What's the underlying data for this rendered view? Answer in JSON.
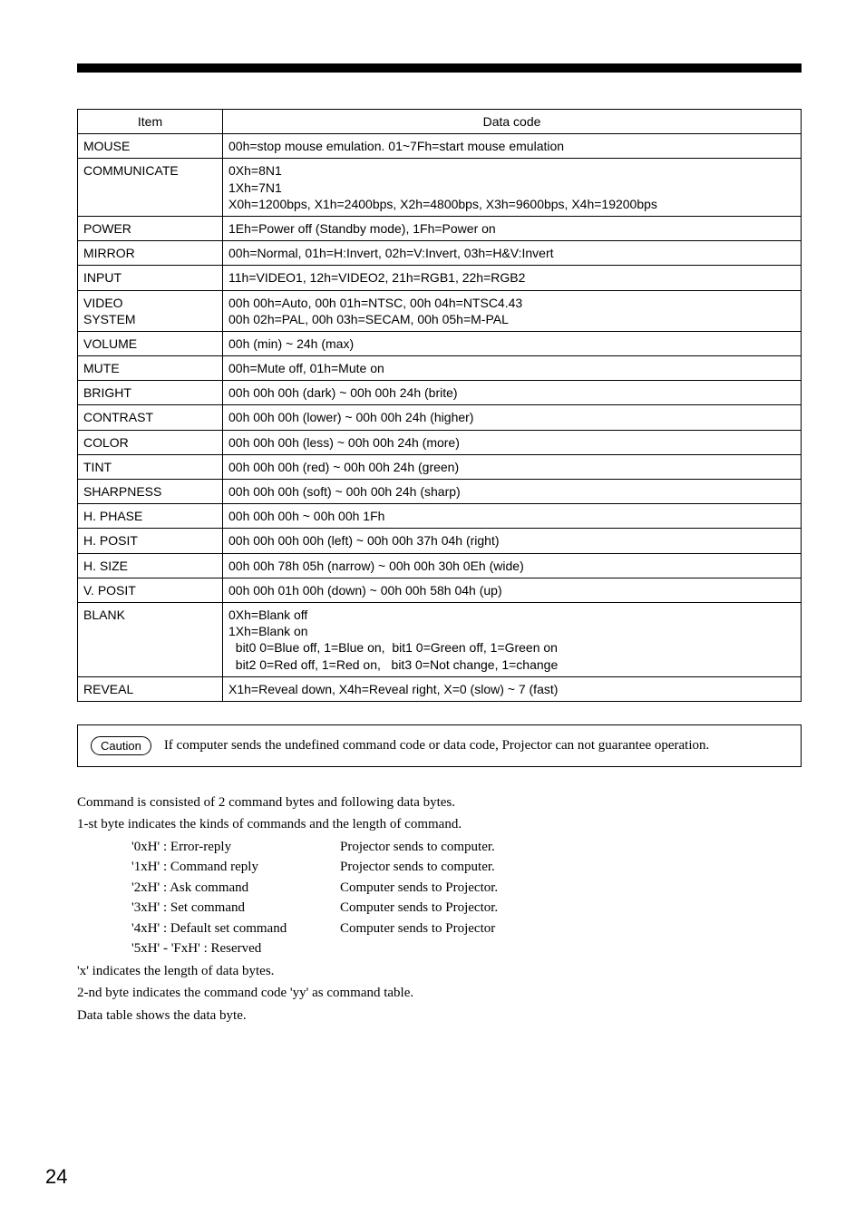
{
  "table": {
    "head_item": "Item",
    "head_data": "Data code",
    "rows": [
      {
        "item": "MOUSE",
        "data": "00h=stop mouse emulation. 01~7Fh=start mouse emulation"
      },
      {
        "item": "COMMUNICATE",
        "data": "0Xh=8N1\n1Xh=7N1\nX0h=1200bps, X1h=2400bps, X2h=4800bps, X3h=9600bps, X4h=19200bps"
      },
      {
        "item": "POWER",
        "data": "1Eh=Power off (Standby mode), 1Fh=Power on"
      },
      {
        "item": "MIRROR",
        "data": "00h=Normal, 01h=H:Invert, 02h=V:Invert, 03h=H&V:Invert"
      },
      {
        "item": "INPUT",
        "data": "11h=VIDEO1, 12h=VIDEO2, 21h=RGB1, 22h=RGB2"
      },
      {
        "item": "VIDEO\nSYSTEM",
        "data": "00h 00h=Auto, 00h 01h=NTSC, 00h 04h=NTSC4.43\n00h 02h=PAL, 00h 03h=SECAM, 00h 05h=M-PAL"
      },
      {
        "item": "VOLUME",
        "data": "00h (min) ~ 24h (max)"
      },
      {
        "item": "MUTE",
        "data": "00h=Mute off, 01h=Mute on"
      },
      {
        "item": "BRIGHT",
        "data": "00h 00h 00h (dark) ~ 00h 00h 24h (brite)"
      },
      {
        "item": "CONTRAST",
        "data": "00h 00h 00h (lower) ~ 00h 00h 24h (higher)"
      },
      {
        "item": "COLOR",
        "data": "00h 00h 00h (less) ~ 00h 00h 24h (more)"
      },
      {
        "item": "TINT",
        "data": "00h 00h 00h (red) ~ 00h 00h 24h (green)"
      },
      {
        "item": "SHARPNESS",
        "data": "00h 00h 00h (soft) ~ 00h 00h 24h (sharp)"
      },
      {
        "item": "H. PHASE",
        "data": "00h 00h 00h ~ 00h 00h 1Fh"
      },
      {
        "item": "H. POSIT",
        "data": "00h 00h 00h 00h (left) ~ 00h 00h 37h 04h (right)"
      },
      {
        "item": "H. SIZE",
        "data": "00h 00h 78h 05h (narrow) ~ 00h 00h 30h 0Eh (wide)"
      },
      {
        "item": "V. POSIT",
        "data": "00h 00h 01h 00h (down) ~ 00h 00h 58h 04h (up)"
      },
      {
        "item": "BLANK",
        "data": "0Xh=Blank off\n1Xh=Blank on\n  bit0 0=Blue off, 1=Blue on,  bit1 0=Green off, 1=Green on\n  bit2 0=Red off, 1=Red on,   bit3 0=Not change, 1=change"
      },
      {
        "item": "REVEAL",
        "data": "X1h=Reveal down, X4h=Reveal right, X=0 (slow) ~ 7 (fast)"
      }
    ]
  },
  "caution": {
    "label": "Caution",
    "text": "If computer sends the undefined command code or data code, Projector can not guarantee operation."
  },
  "prose": {
    "p1": "Command is consisted of 2 command bytes and following data bytes.",
    "p2": "1-st byte indicates the kinds of commands and the length of command.",
    "cmds": [
      {
        "l": "'0xH' : Error-reply",
        "r": "Projector sends to computer."
      },
      {
        "l": "'1xH' : Command reply",
        "r": "Projector sends to computer."
      },
      {
        "l": "'2xH' : Ask  command",
        "r": "Computer sends to Projector."
      },
      {
        "l": "'3xH' : Set command",
        "r": "Computer sends to Projector."
      },
      {
        "l": "'4xH' : Default set command",
        "r": "Computer sends to Projector"
      },
      {
        "l": "'5xH' - 'FxH' : Reserved",
        "r": ""
      }
    ],
    "p3": "'x' indicates the length of data bytes.",
    "p4": "2-nd byte indicates the command code 'yy' as command table.",
    "p5": "Data table shows the data byte."
  },
  "page_number": "24"
}
